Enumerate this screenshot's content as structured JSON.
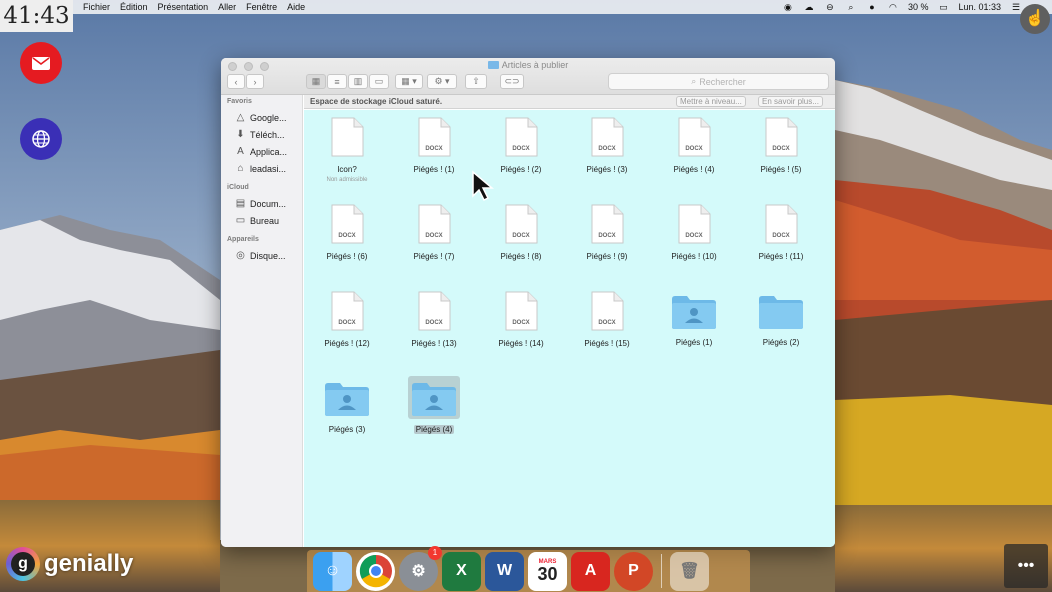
{
  "timer": "41:43",
  "menubar": {
    "items": [
      "Fichier",
      "Édition",
      "Présentation",
      "Aller",
      "Fenêtre",
      "Aide"
    ],
    "battery": "30 %",
    "clock": "Lun. 01:33",
    "status_icons": [
      "app-icon",
      "cloud-icon",
      "sync-icon",
      "search-icon",
      "user-icon",
      "wifi-icon",
      "battery-icon",
      "menu-icon"
    ]
  },
  "window": {
    "title": "Articles à publier",
    "search_placeholder": "Rechercher",
    "storage_message": "Espace de stockage iCloud saturé.",
    "upgrade_button": "Mettre à niveau...",
    "learn_more_button": "En savoir plus..."
  },
  "sidebar": {
    "sections": [
      {
        "title": "Favoris",
        "items": [
          {
            "label": "Google...",
            "icon": "drive-icon"
          },
          {
            "label": "Téléch...",
            "icon": "download-icon"
          },
          {
            "label": "Applica...",
            "icon": "applications-icon"
          },
          {
            "label": "leadasi...",
            "icon": "home-icon"
          }
        ]
      },
      {
        "title": "iCloud",
        "items": [
          {
            "label": "Docum...",
            "icon": "documents-icon"
          },
          {
            "label": "Bureau",
            "icon": "desktop-icon"
          }
        ]
      },
      {
        "title": "Appareils",
        "items": [
          {
            "label": "Disque...",
            "icon": "disk-icon"
          }
        ]
      }
    ]
  },
  "files": [
    {
      "name": "Icon?",
      "sub": "Non admissible",
      "type": "blank"
    },
    {
      "name": "Piégés ! (1)",
      "type": "docx"
    },
    {
      "name": "Piégés ! (2)",
      "type": "docx"
    },
    {
      "name": "Piégés ! (3)",
      "type": "docx"
    },
    {
      "name": "Piégés ! (4)",
      "type": "docx"
    },
    {
      "name": "Piégés ! (5)",
      "type": "docx"
    },
    {
      "name": "Piégés ! (6)",
      "type": "docx"
    },
    {
      "name": "Piégés ! (7)",
      "type": "docx"
    },
    {
      "name": "Piégés ! (8)",
      "type": "docx"
    },
    {
      "name": "Piégés ! (9)",
      "type": "docx"
    },
    {
      "name": "Piégés ! (10)",
      "type": "docx"
    },
    {
      "name": "Piégés ! (11)",
      "type": "docx"
    },
    {
      "name": "Piégés ! (12)",
      "type": "docx"
    },
    {
      "name": "Piégés ! (13)",
      "type": "docx"
    },
    {
      "name": "Piégés ! (14)",
      "type": "docx"
    },
    {
      "name": "Piégés ! (15)",
      "type": "docx"
    },
    {
      "name": "Piégés (1)",
      "type": "shared-folder"
    },
    {
      "name": "Piégés (2)",
      "type": "folder"
    },
    {
      "name": "Piégés (3)",
      "type": "shared-folder"
    },
    {
      "name": "Piégés (4)",
      "type": "shared-folder",
      "selected": true
    }
  ],
  "doc_tag": "DOCX",
  "dock": {
    "apps": [
      "finder-icon",
      "chrome-icon",
      "system-preferences-icon",
      "excel-icon",
      "word-icon",
      "calendar-icon",
      "acrobat-icon",
      "powerpoint-icon",
      "trash-icon"
    ],
    "badge": "1",
    "calendar_month": "MARS",
    "calendar_day": "30"
  },
  "brand": "genially",
  "colors": {
    "content_bg": "#d4fafa",
    "folder": "#78c4ee",
    "mail": "#e51b21",
    "globe": "#3a2fb6"
  }
}
